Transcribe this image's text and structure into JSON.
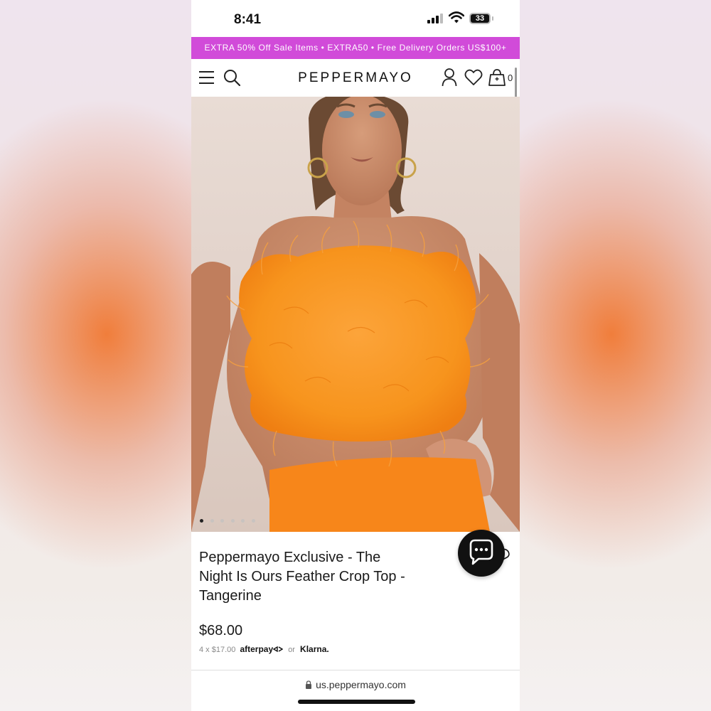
{
  "status_bar": {
    "time": "8:41",
    "battery": "33"
  },
  "promo": {
    "text": "EXTRA 50% Off Sale Items • EXTRA50 • Free Delivery Orders US$100+"
  },
  "header": {
    "brand": "PEPPERMAYO",
    "bag_count": "0",
    "icons": [
      "menu-icon",
      "search-icon",
      "account-icon",
      "heart-icon",
      "bag-icon"
    ]
  },
  "carousel": {
    "slide_count": 6,
    "active_index": 0
  },
  "product": {
    "title": "Peppermayo Exclusive - The Night Is Ours Feather Crop Top - Tangerine",
    "price": "$68.00",
    "installment": "4 x $17.00",
    "afterpay_label": "afterpay",
    "or_label": "or",
    "klarna_label": "Klarna."
  },
  "browser": {
    "url": "us.peppermayo.com"
  },
  "colors": {
    "promo_bg": "#d14bd9",
    "top_orange": "#f7941d",
    "chat_bg": "#111111"
  }
}
